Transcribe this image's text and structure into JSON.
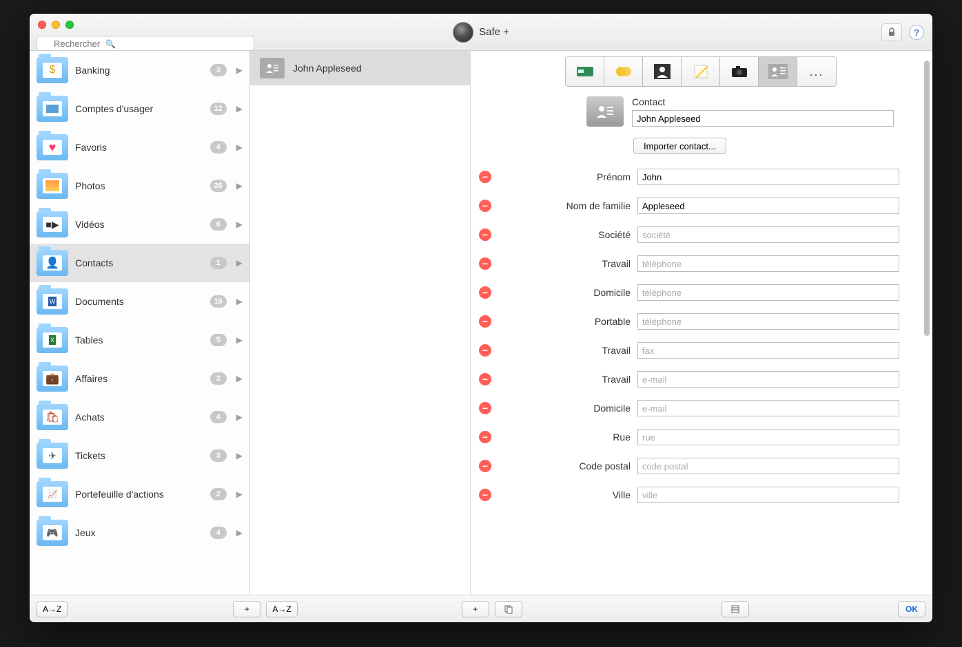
{
  "app": {
    "title": "Safe +"
  },
  "search": {
    "placeholder": "Rechercher"
  },
  "titlebar": {
    "lock_icon": "lock-icon",
    "help_icon": "help-icon"
  },
  "sidebar": {
    "items": [
      {
        "label": "Banking",
        "count": "3",
        "icon": "money-icon"
      },
      {
        "label": "Comptes d'usager",
        "count": "12",
        "icon": "accounts-icon"
      },
      {
        "label": "Favoris",
        "count": "4",
        "icon": "heart-icon"
      },
      {
        "label": "Photos",
        "count": "26",
        "icon": "photo-icon"
      },
      {
        "label": "Vidéos",
        "count": "6",
        "icon": "video-icon"
      },
      {
        "label": "Contacts",
        "count": "1",
        "icon": "contact-icon",
        "selected": true
      },
      {
        "label": "Documents",
        "count": "15",
        "icon": "doc-icon"
      },
      {
        "label": "Tables",
        "count": "5",
        "icon": "table-icon"
      },
      {
        "label": "Affaires",
        "count": "2",
        "icon": "briefcase-icon"
      },
      {
        "label": "Achats",
        "count": "4",
        "icon": "shopping-icon"
      },
      {
        "label": "Tickets",
        "count": "3",
        "icon": "plane-icon"
      },
      {
        "label": "Portefeuille d'actions",
        "count": "2",
        "icon": "stocks-icon"
      },
      {
        "label": "Jeux",
        "count": "4",
        "icon": "gamepad-icon"
      }
    ]
  },
  "entries": {
    "items": [
      {
        "label": "John Appleseed",
        "selected": true
      }
    ]
  },
  "type_tabs": [
    {
      "name": "card-icon"
    },
    {
      "name": "money-icon"
    },
    {
      "name": "person-icon"
    },
    {
      "name": "note-icon"
    },
    {
      "name": "camera-icon"
    },
    {
      "name": "contact-icon",
      "selected": true
    },
    {
      "name": "more-icon"
    }
  ],
  "detail": {
    "type_label": "Contact",
    "name_value": "John Appleseed",
    "import_label": "Importer contact...",
    "fields": [
      {
        "label": "Prénom",
        "value": "John",
        "placeholder": ""
      },
      {
        "label": "Nom de familie",
        "value": "Appleseed",
        "placeholder": ""
      },
      {
        "label": "Société",
        "value": "",
        "placeholder": "société"
      },
      {
        "label": "Travail",
        "value": "",
        "placeholder": "téléphone"
      },
      {
        "label": "Domicile",
        "value": "",
        "placeholder": "téléphone"
      },
      {
        "label": "Portable",
        "value": "",
        "placeholder": "téléphone"
      },
      {
        "label": "Travail",
        "value": "",
        "placeholder": "fax"
      },
      {
        "label": "Travail",
        "value": "",
        "placeholder": "e-mail"
      },
      {
        "label": "Domicile",
        "value": "",
        "placeholder": "e-mail"
      },
      {
        "label": "Rue",
        "value": "",
        "placeholder": "rue"
      },
      {
        "label": "Code postal",
        "value": "",
        "placeholder": "code postal"
      },
      {
        "label": "Ville",
        "value": "",
        "placeholder": "ville"
      }
    ]
  },
  "footer": {
    "sort_label": "A→Z",
    "add_label": "+",
    "ok_label": "OK"
  }
}
